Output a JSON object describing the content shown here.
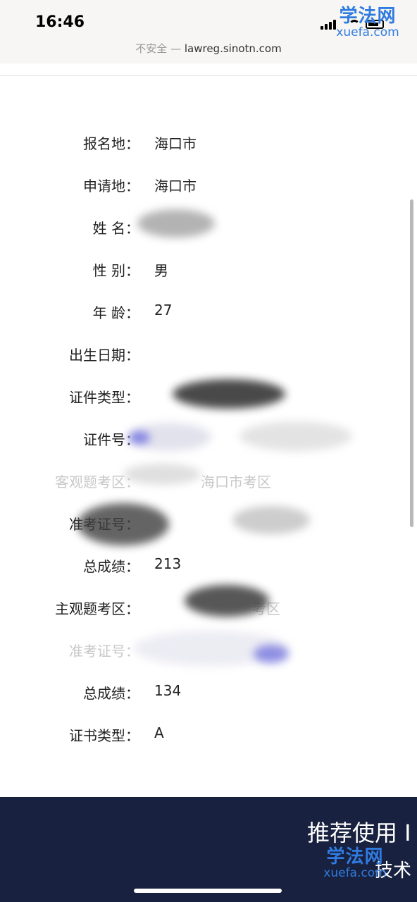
{
  "status_bar": {
    "time": "16:46"
  },
  "browser": {
    "insecure_label": "不安全",
    "separator": " — ",
    "domain": "lawreg.sinotn.com"
  },
  "watermark": {
    "cn": "学法网",
    "en": "xuefa.com"
  },
  "form": {
    "rows": [
      {
        "label": "报名地：",
        "value": "海口市"
      },
      {
        "label": "申请地：",
        "value": "海口市"
      },
      {
        "label": "姓 名：",
        "value": ""
      },
      {
        "label": "性 别：",
        "value": "男"
      },
      {
        "label": "年 龄：",
        "value": "27"
      },
      {
        "label": "出生日期：",
        "value": ""
      },
      {
        "label": "证件类型：",
        "value": ""
      },
      {
        "label": "证件号：",
        "value": ""
      },
      {
        "label": "客观题考区：",
        "value": "海口市考区"
      },
      {
        "label": "准考证号：",
        "value": ""
      },
      {
        "label": "总成绩：",
        "value": "213"
      },
      {
        "label": "主观题考区：",
        "value": "考区"
      },
      {
        "label": "准考证号：",
        "value": ""
      },
      {
        "label": "总成绩：",
        "value": "134"
      },
      {
        "label": "证书类型：",
        "value": "A"
      }
    ]
  },
  "banner": {
    "title": "推荐使用 I",
    "subtitle": "技术"
  },
  "colors": {
    "banner_bg": "#18213f",
    "watermark": "#2f7be0",
    "status_bg": "#f7f6f4"
  }
}
